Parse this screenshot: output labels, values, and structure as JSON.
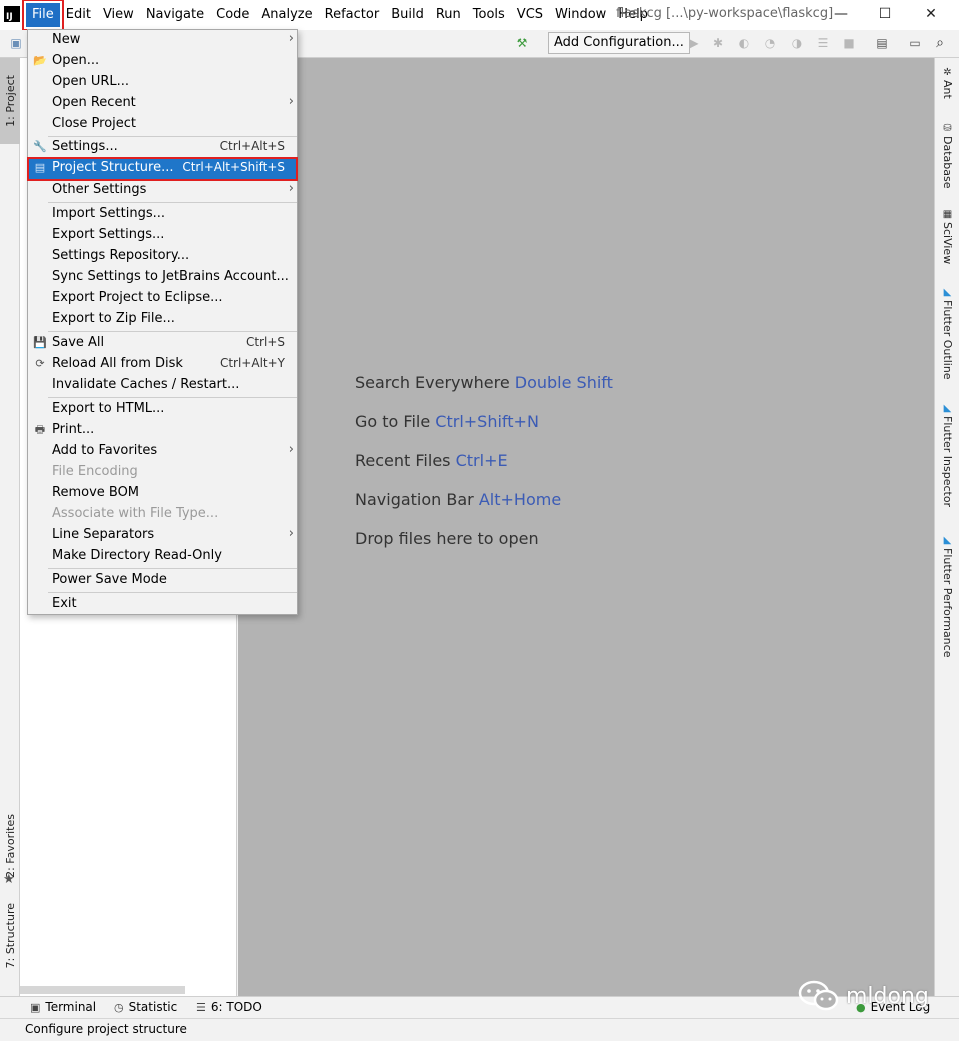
{
  "app": {
    "icon_letter": "IJ",
    "window_title": "flaskcg [...\\py-workspace\\flaskcg]",
    "window_buttons": {
      "minimize": "—",
      "maximize": "☐",
      "close": "✕"
    }
  },
  "menu_bar": [
    "File",
    "Edit",
    "View",
    "Navigate",
    "Code",
    "Analyze",
    "Refactor",
    "Build",
    "Run",
    "Tools",
    "VCS",
    "Window",
    "Help"
  ],
  "toolbar": {
    "add_configuration": "Add Configuration..."
  },
  "left_tabs": [
    "1: Project",
    "2: Favorites",
    "7: Structure"
  ],
  "right_tabs": [
    "Ant",
    "Database",
    "SciView",
    "Flutter Outline",
    "Flutter Inspector",
    "Flutter Performance"
  ],
  "editor_hints": [
    {
      "text": "Search Everywhere",
      "key": "Double Shift"
    },
    {
      "text": "Go to File",
      "key": "Ctrl+Shift+N"
    },
    {
      "text": "Recent Files",
      "key": "Ctrl+E"
    },
    {
      "text": "Navigation Bar",
      "key": "Alt+Home"
    },
    {
      "text": "Drop files here to open",
      "key": ""
    }
  ],
  "bottom_tabs": [
    "Terminal",
    "Statistic",
    "6: TODO"
  ],
  "event_log": "Event Log",
  "status": "Configure project structure",
  "watermark": "mldong",
  "file_menu": {
    "items": {
      "new": {
        "label": "New",
        "submenu": true
      },
      "open": {
        "label": "Open..."
      },
      "open_url": {
        "label": "Open URL..."
      },
      "open_recent": {
        "label": "Open Recent",
        "submenu": true
      },
      "close_project": {
        "label": "Close Project"
      },
      "settings": {
        "label": "Settings...",
        "shortcut": "Ctrl+Alt+S"
      },
      "project_structure": {
        "label": "Project Structure...",
        "shortcut": "Ctrl+Alt+Shift+S"
      },
      "other_settings": {
        "label": "Other Settings",
        "submenu": true
      },
      "import_settings": {
        "label": "Import Settings..."
      },
      "export_settings": {
        "label": "Export Settings..."
      },
      "settings_repository": {
        "label": "Settings Repository..."
      },
      "sync_settings": {
        "label": "Sync Settings to JetBrains Account..."
      },
      "export_eclipse": {
        "label": "Export Project to Eclipse..."
      },
      "export_zip": {
        "label": "Export to Zip File..."
      },
      "save_all": {
        "label": "Save All",
        "shortcut": "Ctrl+S"
      },
      "reload_all": {
        "label": "Reload All from Disk",
        "shortcut": "Ctrl+Alt+Y"
      },
      "invalidate_caches": {
        "label": "Invalidate Caches / Restart..."
      },
      "export_html": {
        "label": "Export to HTML..."
      },
      "print": {
        "label": "Print..."
      },
      "add_favorites": {
        "label": "Add to Favorites",
        "submenu": true
      },
      "file_encoding": {
        "label": "File Encoding",
        "disabled": true
      },
      "remove_bom": {
        "label": "Remove BOM"
      },
      "associate_file_type": {
        "label": "Associate with File Type...",
        "disabled": true
      },
      "line_separators": {
        "label": "Line Separators",
        "submenu": true
      },
      "make_read_only": {
        "label": "Make Directory Read-Only"
      },
      "power_save": {
        "label": "Power Save Mode"
      },
      "exit": {
        "label": "Exit"
      }
    }
  },
  "colors": {
    "highlight": "#1f76c9",
    "annotation_red": "#e02020",
    "editor_bg": "#b3b3b3",
    "hint_key": "#3b5bb5"
  }
}
